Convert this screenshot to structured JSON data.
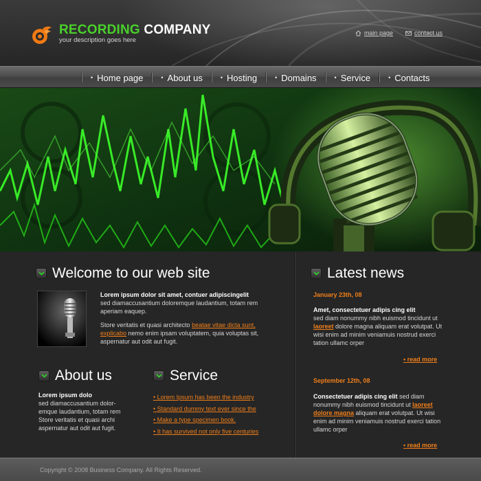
{
  "brand": {
    "word1": "RECORDING",
    "word2": "COMPANY",
    "tagline": "your description goes here",
    "accent_color": "#49d12a",
    "link_color": "#f07f1a"
  },
  "toplinks": [
    {
      "label": "main page",
      "icon": "home-icon"
    },
    {
      "label": "contact us",
      "icon": "envelope-icon"
    }
  ],
  "nav": [
    "Home page",
    "About us",
    "Hosting",
    "Domains",
    "Service",
    "Contacts"
  ],
  "welcome": {
    "title": "Welcome to our web site",
    "lead": "Lorem ipsum dolor sit amet, contuer adipiscingelit",
    "body1": "sed diamaccusantium doloremque laudantium, totam rem aperiam eaquep.",
    "body2_pre": "Store veritatis et quasi architecto ",
    "body2_link": "beatae vitae dicta sunt, explicabo",
    "body2_post": " nemo enim ipsam voluptatem, quia voluptas sit, aspernatur aut odit aut fugit."
  },
  "about": {
    "title": "About us",
    "lead": "Lorem ipsum dolo",
    "body": "sed diamaccusantium dolor-emque laudantium, totam rem Store veritatis et quasi archi aspernatur aut odit aut fugit."
  },
  "service": {
    "title": "Service",
    "items": [
      "Lorem Ipsum has been the industry",
      "Standard dummy text ever since the",
      "Make a type specimen book.",
      "It has survived not only five centuries"
    ]
  },
  "news": {
    "title": "Latest news",
    "readmore": "read more",
    "items": [
      {
        "date": "January 23th, 08",
        "lead": "Amet, consectetuer adipis cing elit",
        "text1": "sed diam nonummy nibh euismod tincidunt ut ",
        "link": "laoreet",
        "text2": " dolore magna aliquam erat volutpat.  Ut wisi enim ad minim veniamuis nostrud exerci tation ullamc orper"
      },
      {
        "date": "September 12th, 08",
        "lead": "Consectetuer adipis cing elit",
        "text1": " sed diam nonummy nibh euismod tincidunt ut ",
        "link": "laoreet dolore magna",
        "text2": " aliquam erat volutpat.  Ut wisi enim ad minim veniamuis nostrud exerci tation ullamc orper"
      }
    ]
  },
  "footer": {
    "copyright": "Copyright © 2008 Business Company. All Rights Reserved."
  }
}
